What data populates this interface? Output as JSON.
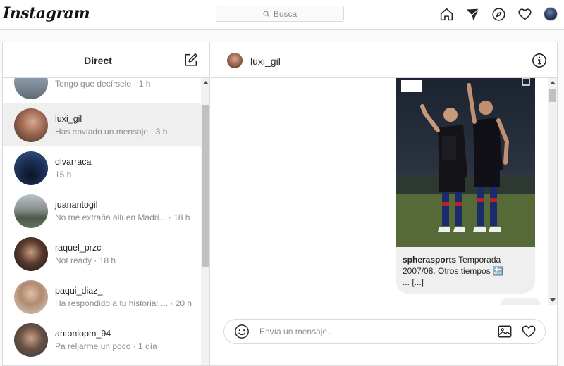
{
  "topnav": {
    "logo": "Instagram",
    "search_placeholder": "Busca",
    "icons": [
      "home-icon",
      "direct-send-icon",
      "explore-compass-icon",
      "heart-icon",
      "profile-avatar"
    ]
  },
  "sidebar": {
    "title": "Direct",
    "conversations": [
      {
        "name": "",
        "preview": "Tengo que decírselo · 1 h"
      },
      {
        "name": "luxi_gil",
        "preview": "Has enviado un mensaje · 3 h",
        "active": true
      },
      {
        "name": "divarraca",
        "preview": "15 h"
      },
      {
        "name": "juanantogil",
        "preview": "No me extraña allí en Madri... · 18 h"
      },
      {
        "name": "raquel_przc",
        "preview": "Not ready · 18 h"
      },
      {
        "name": "paqui_diaz_",
        "preview": "Ha respondido a tu historia: ... · 20 h"
      },
      {
        "name": "antoniopm_94",
        "preview": "Pa reljarme un poco · 1 día"
      }
    ]
  },
  "chat": {
    "username": "luxi_gil",
    "post": {
      "account": "spherasports",
      "text": "Temporada 2007/08. Otros tiempos 🔙",
      "more": "... [...]"
    },
    "composer_placeholder": "Envía un mensaje..."
  },
  "colors": {
    "border": "#dbdbdb",
    "muted_text": "#8e8e8e",
    "active_row": "#efefef"
  }
}
